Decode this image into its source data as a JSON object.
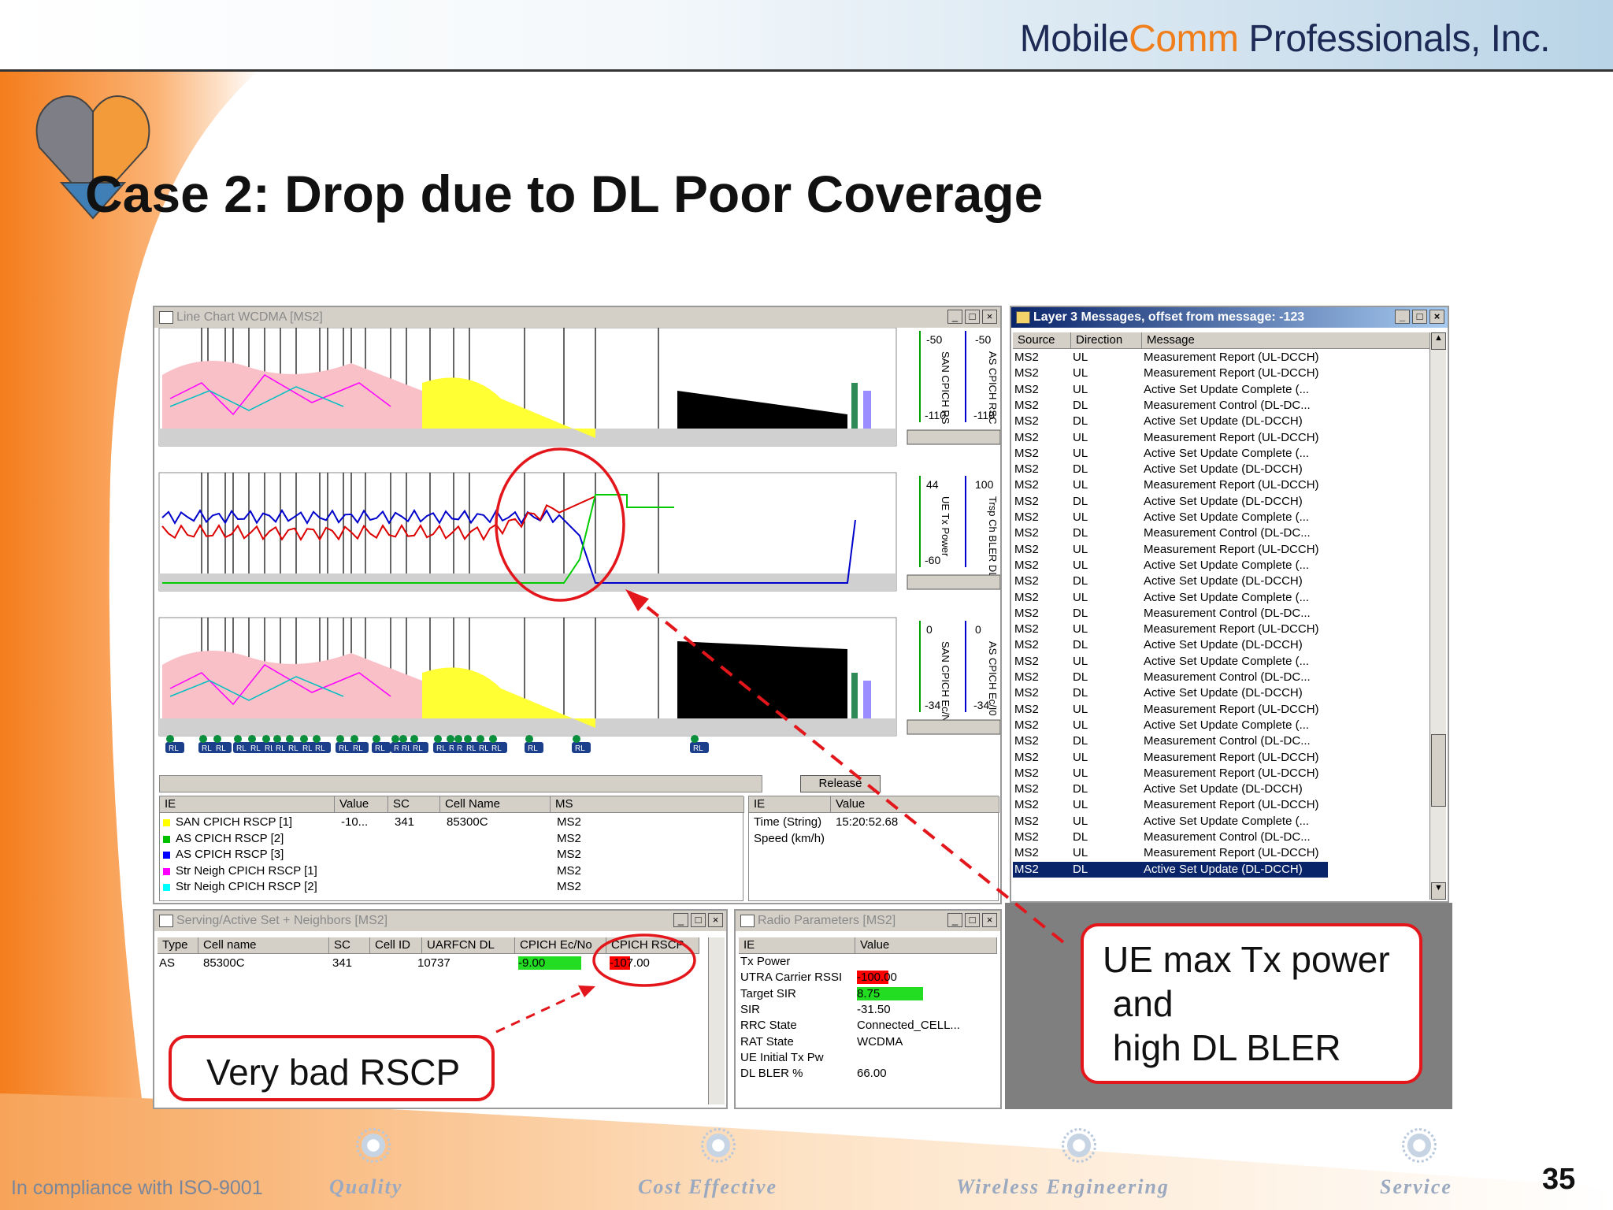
{
  "header": {
    "company_prefix": "Mobile",
    "company_accent": "Comm",
    "company_suffix": " Professionals, Inc."
  },
  "slide": {
    "title": "Case 2: Drop due to DL Poor Coverage",
    "page_number": "35"
  },
  "line_chart": {
    "title": "Line Chart WCDMA [MS2]",
    "panels": [
      {
        "left_axis": "SAN CPICH RS",
        "left_top": "-50",
        "left_bottom": "-110",
        "right_axis": "AS CPICH RSC",
        "right_top": "-50",
        "right_bottom": "-110"
      },
      {
        "left_axis": "UE Tx Power",
        "left_top": "44",
        "left_bottom": "-60",
        "right_axis": "Trsp Ch BLER DL",
        "right_top": "100",
        "right_bottom": ""
      },
      {
        "left_axis": "SAN CPICH Ec/No",
        "left_top": "0",
        "left_bottom": "-34",
        "right_axis": "AS CPICH Ec/I0",
        "right_top": "0",
        "right_bottom": "-34"
      }
    ],
    "event_label": "RL",
    "release_button": "Release",
    "legend_headers": [
      "IE",
      "Value",
      "SC",
      "Cell Name",
      "MS"
    ],
    "legend_rows": [
      {
        "color": "#ffff00",
        "ie": "SAN CPICH RSCP [1]",
        "value": "-10...",
        "sc": "341",
        "cell": "85300C",
        "ms": "MS2"
      },
      {
        "color": "#00c000",
        "ie": "AS CPICH RSCP [2]",
        "value": "",
        "sc": "",
        "cell": "",
        "ms": "MS2"
      },
      {
        "color": "#0000ff",
        "ie": "AS CPICH RSCP [3]",
        "value": "",
        "sc": "",
        "cell": "",
        "ms": "MS2"
      },
      {
        "color": "#ff00ff",
        "ie": "Str Neigh CPICH RSCP [1]",
        "value": "",
        "sc": "",
        "cell": "",
        "ms": "MS2"
      },
      {
        "color": "#00ffff",
        "ie": "Str Neigh CPICH RSCP [2]",
        "value": "",
        "sc": "",
        "cell": "",
        "ms": "MS2"
      }
    ],
    "info_headers": [
      "IE",
      "Value"
    ],
    "info_rows": [
      {
        "ie": "Time (String)",
        "value": "15:20:52.68"
      },
      {
        "ie": "Speed (km/h)",
        "value": ""
      }
    ]
  },
  "layer3": {
    "title": "Layer 3 Messages, offset from message: -123",
    "headers": [
      "Source",
      "Direction",
      "Message"
    ],
    "rows": [
      [
        "MS2",
        "UL",
        "Measurement Report (UL-DCCH)"
      ],
      [
        "MS2",
        "UL",
        "Measurement Report (UL-DCCH)"
      ],
      [
        "MS2",
        "UL",
        "Active Set Update Complete (..."
      ],
      [
        "MS2",
        "DL",
        "Measurement Control (DL-DC..."
      ],
      [
        "MS2",
        "DL",
        "Active Set Update (DL-DCCH)"
      ],
      [
        "MS2",
        "UL",
        "Measurement Report (UL-DCCH)"
      ],
      [
        "MS2",
        "UL",
        "Active Set Update Complete (..."
      ],
      [
        "MS2",
        "DL",
        "Active Set Update (DL-DCCH)"
      ],
      [
        "MS2",
        "UL",
        "Measurement Report (UL-DCCH)"
      ],
      [
        "MS2",
        "DL",
        "Active Set Update (DL-DCCH)"
      ],
      [
        "MS2",
        "UL",
        "Active Set Update Complete (..."
      ],
      [
        "MS2",
        "DL",
        "Measurement Control (DL-DC..."
      ],
      [
        "MS2",
        "UL",
        "Measurement Report (UL-DCCH)"
      ],
      [
        "MS2",
        "UL",
        "Active Set Update Complete (..."
      ],
      [
        "MS2",
        "DL",
        "Active Set Update (DL-DCCH)"
      ],
      [
        "MS2",
        "UL",
        "Active Set Update Complete (..."
      ],
      [
        "MS2",
        "DL",
        "Measurement Control (DL-DC..."
      ],
      [
        "MS2",
        "UL",
        "Measurement Report (UL-DCCH)"
      ],
      [
        "MS2",
        "DL",
        "Active Set Update (DL-DCCH)"
      ],
      [
        "MS2",
        "UL",
        "Active Set Update Complete (..."
      ],
      [
        "MS2",
        "DL",
        "Measurement Control (DL-DC..."
      ],
      [
        "MS2",
        "DL",
        "Active Set Update (DL-DCCH)"
      ],
      [
        "MS2",
        "UL",
        "Measurement Report (UL-DCCH)"
      ],
      [
        "MS2",
        "UL",
        "Active Set Update Complete (..."
      ],
      [
        "MS2",
        "DL",
        "Measurement Control (DL-DC..."
      ],
      [
        "MS2",
        "UL",
        "Measurement Report (UL-DCCH)"
      ],
      [
        "MS2",
        "UL",
        "Measurement Report (UL-DCCH)"
      ],
      [
        "MS2",
        "DL",
        "Active Set Update (DL-DCCH)"
      ],
      [
        "MS2",
        "UL",
        "Measurement Report (UL-DCCH)"
      ],
      [
        "MS2",
        "UL",
        "Active Set Update Complete (..."
      ],
      [
        "MS2",
        "DL",
        "Measurement Control (DL-DC..."
      ],
      [
        "MS2",
        "UL",
        "Measurement Report (UL-DCCH)"
      ],
      [
        "MS2",
        "DL",
        "Active Set Update (DL-DCCH)"
      ]
    ],
    "selected_index": 32
  },
  "serving": {
    "title": "Serving/Active Set + Neighbors [MS2]",
    "headers": [
      "Type",
      "Cell name",
      "SC",
      "Cell ID",
      "UARFCN DL",
      "CPICH Ec/No",
      "CPICH RSCP"
    ],
    "row": {
      "type": "AS",
      "cell": "85300C",
      "sc": "341",
      "cellid": "",
      "uarfcn": "10737",
      "ecno": "-9.00",
      "rscp": "-107.00"
    }
  },
  "radio": {
    "title": "Radio Parameters [MS2]",
    "headers": [
      "IE",
      "Value"
    ],
    "rows": [
      {
        "ie": "Tx Power",
        "value": ""
      },
      {
        "ie": "UTRA Carrier RSSI",
        "value": "-100.00"
      },
      {
        "ie": "Target SIR",
        "value": "8.75"
      },
      {
        "ie": "SIR",
        "value": "-31.50"
      },
      {
        "ie": "RRC State",
        "value": "Connected_CELL..."
      },
      {
        "ie": "RAT State",
        "value": "WCDMA"
      },
      {
        "ie": "UE Initial Tx Pw",
        "value": ""
      },
      {
        "ie": "DL BLER %",
        "value": "66.00"
      }
    ]
  },
  "callouts": {
    "rscp": "Very bad RSCP",
    "tx_line1": "UE max Tx power",
    "tx_line2": " and",
    "tx_line3": " high DL BLER"
  },
  "footer": {
    "iso": "In compliance with ISO-9001",
    "words": [
      "Quality",
      "Cost Effective",
      "Wireless Engineering",
      "Service"
    ]
  },
  "colors": {
    "accent_orange": "#f07e1b",
    "callout_red": "#e3161b",
    "selection_blue": "#0a246a"
  }
}
